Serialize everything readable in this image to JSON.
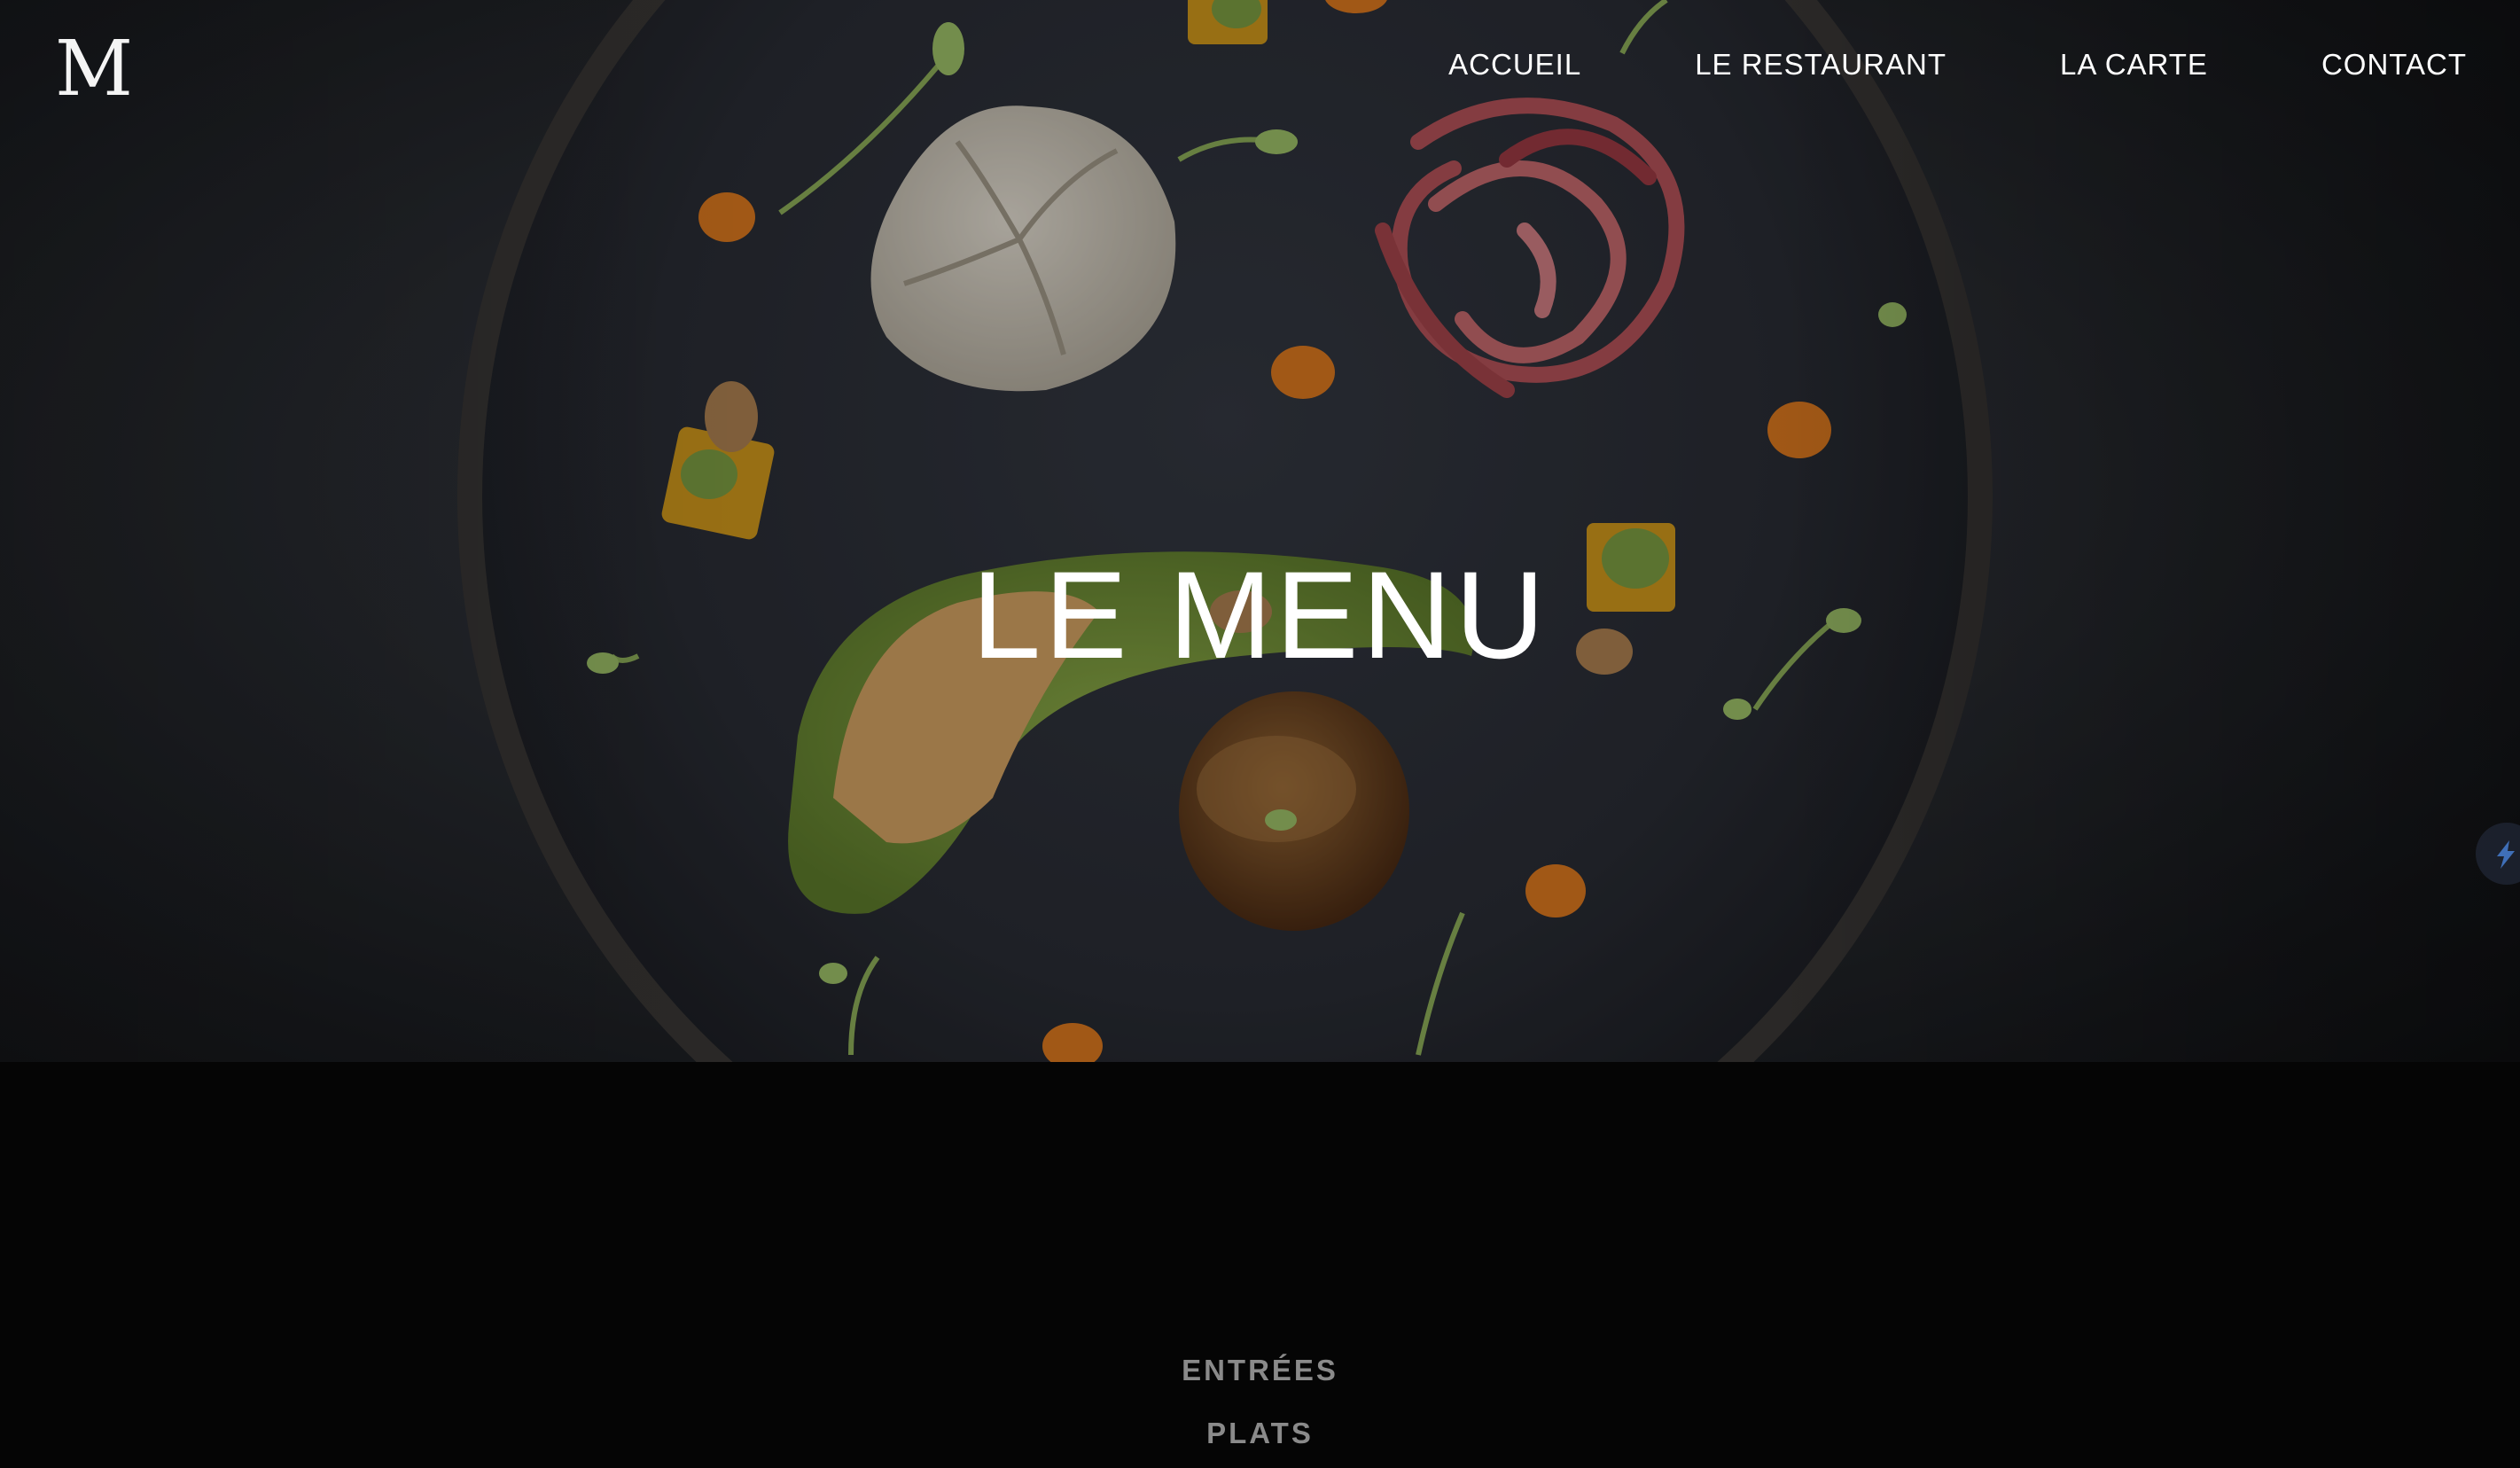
{
  "header": {
    "logo": "M",
    "nav": [
      {
        "label": "ACCUEIL"
      },
      {
        "label": "LE RESTAURANT"
      },
      {
        "label": "LA CARTE"
      },
      {
        "label": "CONTACT"
      }
    ]
  },
  "hero": {
    "title": "LE MENU"
  },
  "menu": {
    "categories": [
      {
        "label": "ENTRÉES"
      },
      {
        "label": "PLATS"
      }
    ]
  },
  "colors": {
    "background": "#050505",
    "text": "#ffffff",
    "category_text": "#8a8a8a"
  }
}
